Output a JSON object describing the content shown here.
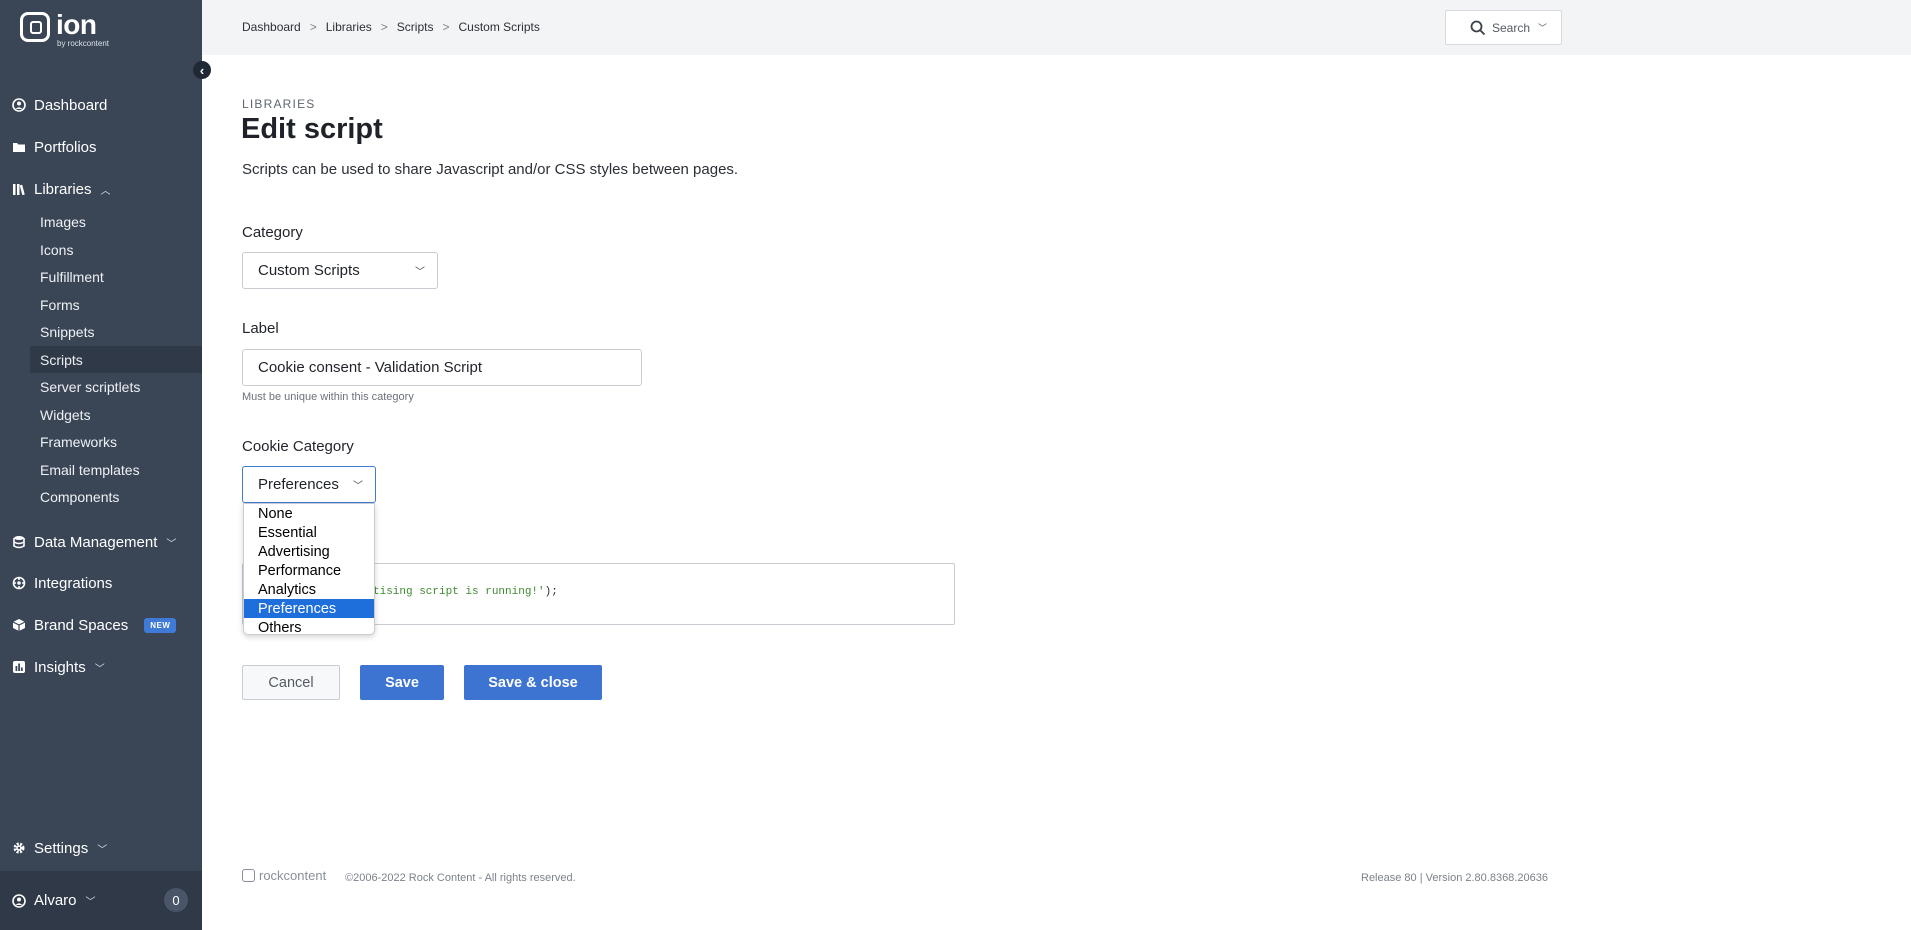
{
  "brand": {
    "name": "ion",
    "sub": "by rockcontent"
  },
  "sidebar": {
    "items": [
      {
        "label": "Dashboard",
        "icon": "dashboard-icon"
      },
      {
        "label": "Portfolios",
        "icon": "folder-icon"
      },
      {
        "label": "Libraries",
        "icon": "library-icon"
      },
      {
        "label": "Data Management",
        "icon": "database-icon"
      },
      {
        "label": "Integrations",
        "icon": "integrations-icon"
      },
      {
        "label": "Brand Spaces",
        "icon": "cube-icon",
        "badge": "NEW"
      },
      {
        "label": "Insights",
        "icon": "chart-icon"
      },
      {
        "label": "Settings",
        "icon": "gear-icon"
      }
    ],
    "libraries_sub": [
      "Images",
      "Icons",
      "Fulfillment",
      "Forms",
      "Snippets",
      "Scripts",
      "Server scriptlets",
      "Widgets",
      "Frameworks",
      "Email templates",
      "Components"
    ],
    "user": {
      "name": "Alvaro",
      "count": "0"
    }
  },
  "topbar": {
    "breadcrumb": [
      "Dashboard",
      "Libraries",
      "Scripts",
      "Custom Scripts"
    ],
    "separator": ">",
    "search_label": "Search"
  },
  "main": {
    "overline": "LIBRARIES",
    "title": "Edit script",
    "description": "Scripts can be used to share Javascript and/or CSS styles between pages.",
    "category_label": "Category",
    "category_value": "Custom Scripts",
    "label_label": "Label",
    "label_value": "Cookie consent - Validation Script",
    "label_hint": "Must be unique within this category",
    "cookie_label": "Cookie Category",
    "cookie_value": "Preferences",
    "cookie_options": [
      "None",
      "Essential",
      "Advertising",
      "Performance",
      "Analytics",
      "Preferences",
      "Others"
    ],
    "code_before": "",
    "code_string": "tising script is running!'",
    "code_after": ");",
    "buttons": {
      "cancel": "Cancel",
      "save": "Save",
      "save_close": "Save & close"
    }
  },
  "footer": {
    "logo": "rockcontent",
    "copyright": "©2006-2022 Rock Content - All rights reserved.",
    "version": "Release 80 | Version 2.80.8368.20636"
  },
  "colors": {
    "sidebar": "#3a4556",
    "accent": "#3e74d1",
    "selected_option": "#1e6fdc"
  }
}
